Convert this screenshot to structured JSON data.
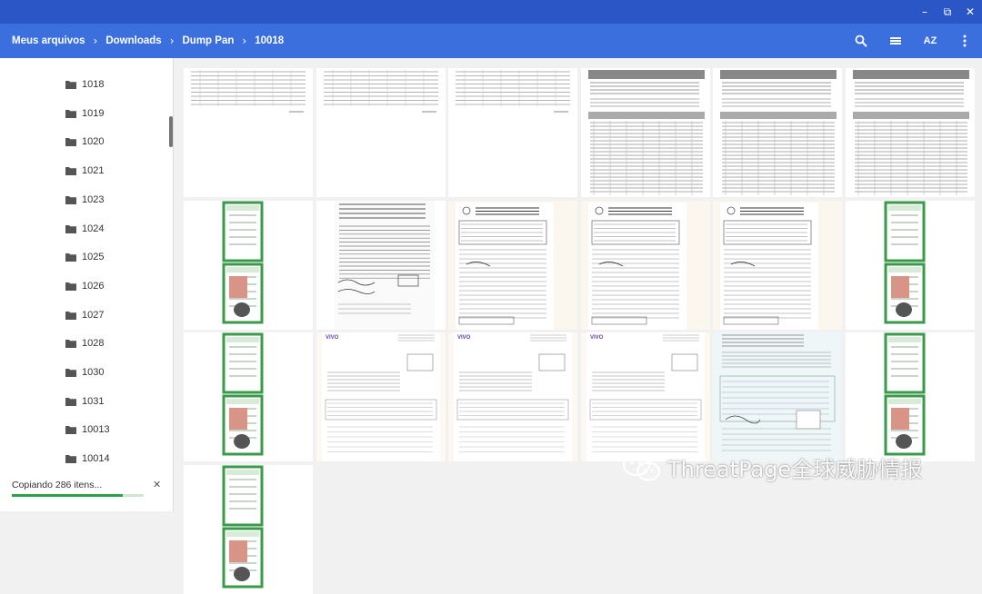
{
  "breadcrumb": [
    "Meus arquivos",
    "Downloads",
    "Dump Pan",
    "10018"
  ],
  "window_controls": {
    "minimize": "–",
    "restore": "⧉",
    "close": "✕"
  },
  "toolbar": {
    "sort_label": "AZ"
  },
  "sidebar": {
    "folders": [
      "1018",
      "1019",
      "1020",
      "1021",
      "1023",
      "1024",
      "1025",
      "1026",
      "1027",
      "1028",
      "1030",
      "1031",
      "10013",
      "10014"
    ]
  },
  "progress": {
    "label": "Copiando 286 itens...",
    "fraction": 0.84,
    "close": "✕"
  },
  "thumbnails": [
    [
      "table-doc",
      "table-doc",
      "table-doc",
      "form-table-doc",
      "form-table-doc",
      "form-table-doc"
    ],
    [
      "id-card",
      "handwritten-doc",
      "official-form",
      "official-form",
      "official-form",
      "id-card"
    ],
    [
      "id-card",
      "vivo-doc",
      "vivo-doc",
      "vivo-doc",
      "blue-form",
      "id-card"
    ],
    [
      "id-card"
    ]
  ],
  "watermark": "ThreatPage全球威胁情报",
  "colors": {
    "titlebar": "#2b56c6",
    "header": "#3b6fde",
    "progress": "#2ba14b"
  }
}
